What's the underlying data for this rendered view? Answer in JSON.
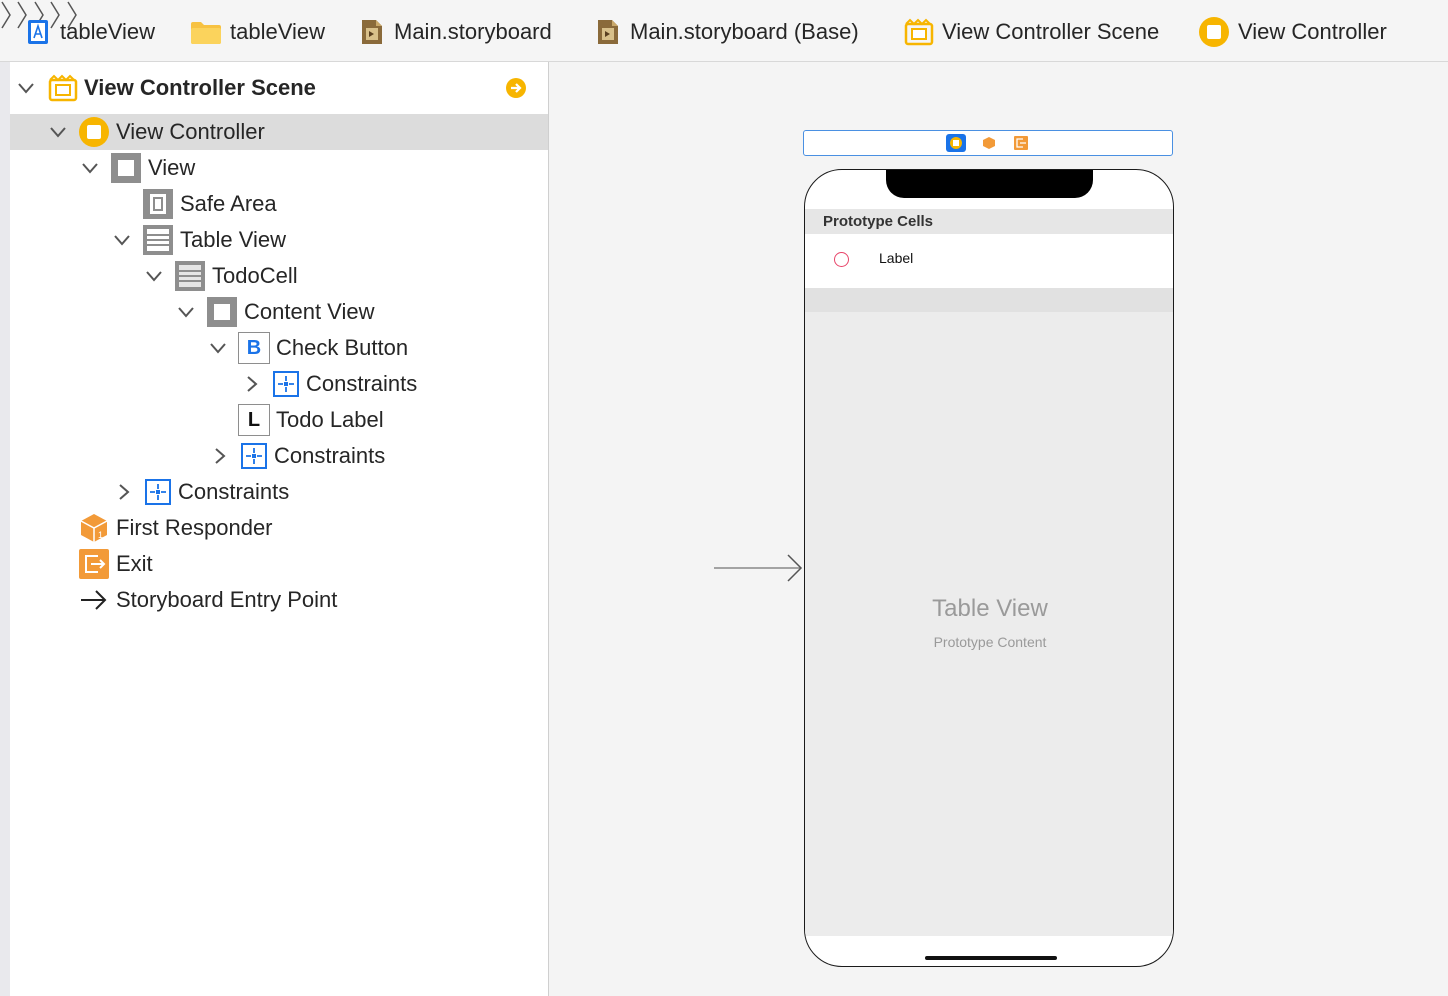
{
  "breadcrumb": [
    {
      "label": "tableView",
      "icon": "xcode-project-icon"
    },
    {
      "label": "tableView",
      "icon": "folder-icon"
    },
    {
      "label": "Main.storyboard",
      "icon": "storyboard-file-icon"
    },
    {
      "label": "Main.storyboard (Base)",
      "icon": "storyboard-file-icon"
    },
    {
      "label": "View Controller Scene",
      "icon": "scene-icon"
    },
    {
      "label": "View Controller",
      "icon": "view-controller-icon"
    }
  ],
  "outline": {
    "scene_title": "View Controller Scene",
    "items": [
      {
        "label": "View Controller",
        "icon": "view-controller-icon",
        "expanded": true,
        "selected": true
      },
      {
        "label": "View",
        "icon": "view-icon",
        "expanded": true
      },
      {
        "label": "Safe Area",
        "icon": "safe-area-icon"
      },
      {
        "label": "Table View",
        "icon": "table-view-icon",
        "expanded": true
      },
      {
        "label": "TodoCell",
        "icon": "table-cell-icon",
        "expanded": true
      },
      {
        "label": "Content View",
        "icon": "view-icon",
        "expanded": true
      },
      {
        "label": "Check Button",
        "icon": "button-icon",
        "expanded": true,
        "glyph": "B"
      },
      {
        "label": "Constraints",
        "icon": "constraints-icon",
        "expanded": false
      },
      {
        "label": "Todo Label",
        "icon": "label-icon",
        "glyph": "L"
      },
      {
        "label": "Constraints",
        "icon": "constraints-icon",
        "expanded": false
      },
      {
        "label": "Constraints",
        "icon": "constraints-icon",
        "expanded": false
      },
      {
        "label": "First Responder",
        "icon": "first-responder-icon"
      },
      {
        "label": "Exit",
        "icon": "exit-icon"
      },
      {
        "label": "Storyboard Entry Point",
        "icon": "arrow-right-icon"
      }
    ]
  },
  "canvas": {
    "prototype_header": "Prototype Cells",
    "cell_label": "Label",
    "table_view_title": "Table View",
    "table_view_subtitle": "Prototype Content"
  },
  "colors": {
    "selection": "#dcdcdc",
    "accent_blue": "#1a73e8",
    "scene_yellow": "#f7b500",
    "responder_orange": "#f29a38",
    "circle_red": "#e8456a"
  }
}
